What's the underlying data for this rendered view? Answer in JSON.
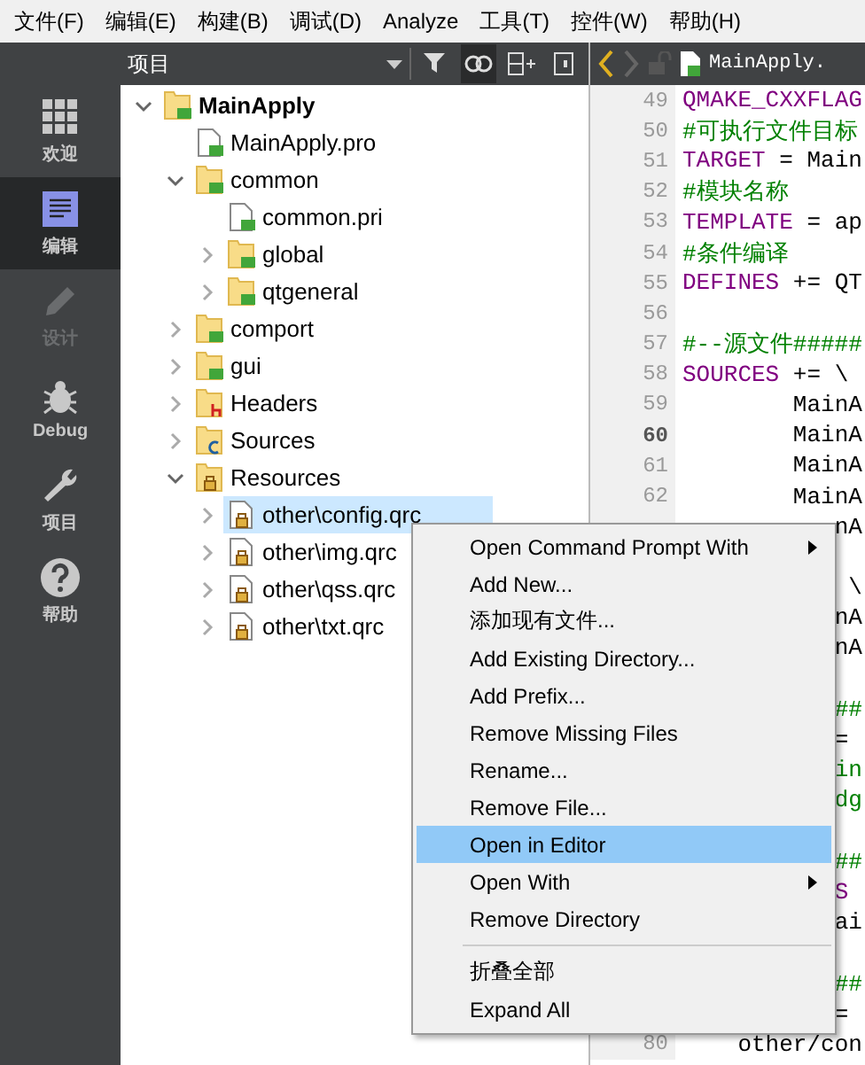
{
  "menu_bar": [
    "文件(F)",
    "编辑(E)",
    "构建(B)",
    "调试(D)",
    "Analyze",
    "工具(T)",
    "控件(W)",
    "帮助(H)"
  ],
  "mode_bar": [
    {
      "label": "欢迎",
      "kind": "welcome",
      "selected": false,
      "disabled": false
    },
    {
      "label": "编辑",
      "kind": "edit",
      "selected": true,
      "disabled": false
    },
    {
      "label": "设计",
      "kind": "design",
      "selected": false,
      "disabled": true
    },
    {
      "label": "Debug",
      "kind": "debug",
      "selected": false,
      "disabled": false
    },
    {
      "label": "项目",
      "kind": "projects",
      "selected": false,
      "disabled": false
    },
    {
      "label": "帮助",
      "kind": "help",
      "selected": false,
      "disabled": false
    }
  ],
  "project_pane": {
    "title": "项目",
    "tree": [
      {
        "label": "MainApply",
        "kind": "qt-folder",
        "expanded": true,
        "selected": false,
        "children": [
          {
            "label": "MainApply.pro",
            "kind": "qt-file",
            "selected": false
          },
          {
            "label": "common",
            "kind": "qt-folder",
            "expanded": true,
            "selected": false,
            "children": [
              {
                "label": "common.pri",
                "kind": "qt-file",
                "selected": false
              },
              {
                "label": "global",
                "kind": "qt-folder",
                "expanded": false,
                "selected": false
              },
              {
                "label": "qtgeneral",
                "kind": "qt-folder",
                "expanded": false,
                "selected": false
              }
            ]
          },
          {
            "label": "comport",
            "kind": "qt-folder",
            "expanded": false,
            "selected": false
          },
          {
            "label": "gui",
            "kind": "qt-folder",
            "expanded": false,
            "selected": false
          },
          {
            "label": "Headers",
            "kind": "header-folder",
            "expanded": false,
            "selected": false
          },
          {
            "label": "Sources",
            "kind": "source-folder",
            "expanded": false,
            "selected": false
          },
          {
            "label": "Resources",
            "kind": "resource-folder",
            "expanded": true,
            "selected": false,
            "children": [
              {
                "label": "other\\config.qrc",
                "kind": "resource-file",
                "expanded": false,
                "selected": true
              },
              {
                "label": "other\\img.qrc",
                "kind": "resource-file",
                "expanded": false,
                "selected": false
              },
              {
                "label": "other\\qss.qrc",
                "kind": "resource-file",
                "expanded": false,
                "selected": false
              },
              {
                "label": "other\\txt.qrc",
                "kind": "resource-file",
                "expanded": false,
                "selected": false
              }
            ]
          }
        ]
      }
    ]
  },
  "editor": {
    "tab_title": "MainApply.",
    "lines": [
      {
        "number": "49",
        "segments": [
          {
            "kind": "keyword",
            "text": "QMAKE_CXXFLAG"
          }
        ]
      },
      {
        "number": "50",
        "segments": [
          {
            "kind": "comment",
            "text": "#可执行文件目标"
          }
        ]
      },
      {
        "number": "51",
        "segments": [
          {
            "kind": "keyword",
            "text": "TARGET"
          },
          {
            "kind": "plain",
            "text": " = Main"
          }
        ]
      },
      {
        "number": "52",
        "segments": [
          {
            "kind": "comment",
            "text": "#模块名称"
          }
        ]
      },
      {
        "number": "53",
        "segments": [
          {
            "kind": "keyword",
            "text": "TEMPLATE"
          },
          {
            "kind": "plain",
            "text": " = ap"
          }
        ]
      },
      {
        "number": "54",
        "segments": [
          {
            "kind": "comment",
            "text": "#条件编译"
          }
        ]
      },
      {
        "number": "55",
        "segments": [
          {
            "kind": "keyword",
            "text": "DEFINES"
          },
          {
            "kind": "plain",
            "text": " += QT"
          }
        ]
      },
      {
        "number": "56"
      },
      {
        "number": "57",
        "segments": [
          {
            "kind": "comment",
            "text": "#--源文件#####"
          }
        ]
      },
      {
        "number": "58",
        "segments": [
          {
            "kind": "keyword",
            "text": "SOURCES"
          },
          {
            "kind": "plain",
            "text": " += \\"
          }
        ]
      },
      {
        "number": "59",
        "segments": [
          {
            "kind": "plain",
            "text": "        MainA"
          }
        ]
      },
      {
        "number": "60",
        "current": true,
        "segments": [
          {
            "kind": "plain",
            "text": "        MainA"
          }
        ]
      },
      {
        "number": "61",
        "segments": [
          {
            "kind": "plain",
            "text": "        MainA"
          }
        ]
      },
      {
        "number": "62",
        "segments": [
          {
            "kind": "plain",
            "text": "        MainA"
          }
        ]
      },
      {
        "segments": [
          {
            "kind": "plain",
            "text": "           nA"
          }
        ]
      },
      {
        "blank_before": true,
        "segments": [
          {
            "kind": "plain",
            "text": "            \\"
          }
        ]
      },
      {
        "segments": [
          {
            "kind": "plain",
            "text": "           nA"
          }
        ]
      },
      {
        "segments": [
          {
            "kind": "plain",
            "text": "           nA"
          }
        ]
      },
      {
        "blank_before": true,
        "segments": [
          {
            "kind": "comment",
            "text": "           ##"
          }
        ]
      },
      {
        "segments": [
          {
            "kind": "plain",
            "text": "           ="
          }
        ]
      },
      {
        "segments": [
          {
            "kind": "comment",
            "text": "           in"
          }
        ]
      },
      {
        "segments": [
          {
            "kind": "comment",
            "text": "           dg"
          }
        ]
      },
      {
        "blank_before": true,
        "segments": [
          {
            "kind": "comment",
            "text": "           ##"
          }
        ]
      },
      {
        "segments": [
          {
            "kind": "keyword",
            "text": "           S"
          }
        ]
      },
      {
        "segments": [
          {
            "kind": "plain",
            "text": "           ai"
          }
        ]
      },
      {
        "blank_before": true,
        "segments": [
          {
            "kind": "comment",
            "text": "           ##"
          }
        ]
      },
      {
        "segments": [
          {
            "kind": "plain",
            "text": "           ="
          }
        ]
      },
      {
        "number": "80",
        "segments": [
          {
            "kind": "plain",
            "text": "    other/con"
          }
        ]
      }
    ]
  },
  "context_menu": [
    {
      "kind": "item",
      "label": "Open Command Prompt With",
      "submenu": true,
      "selected": false
    },
    {
      "kind": "item",
      "label": "Add New...",
      "submenu": false,
      "selected": false
    },
    {
      "kind": "item",
      "label": "添加现有文件...",
      "submenu": false,
      "selected": false
    },
    {
      "kind": "item",
      "label": "Add Existing Directory...",
      "submenu": false,
      "selected": false
    },
    {
      "kind": "item",
      "label": "Add Prefix...",
      "submenu": false,
      "selected": false
    },
    {
      "kind": "item",
      "label": "Remove Missing Files",
      "submenu": false,
      "selected": false
    },
    {
      "kind": "item",
      "label": "Rename...",
      "submenu": false,
      "selected": false
    },
    {
      "kind": "item",
      "label": "Remove File...",
      "submenu": false,
      "selected": false
    },
    {
      "kind": "item",
      "label": "Open in Editor",
      "submenu": false,
      "selected": true
    },
    {
      "kind": "item",
      "label": "Open With",
      "submenu": true,
      "selected": false
    },
    {
      "kind": "item",
      "label": "Remove Directory",
      "submenu": false,
      "selected": false
    },
    {
      "kind": "separator"
    },
    {
      "kind": "item",
      "label": "折叠全部",
      "submenu": false,
      "selected": false
    },
    {
      "kind": "item",
      "label": "Expand All",
      "submenu": false,
      "selected": false
    }
  ]
}
